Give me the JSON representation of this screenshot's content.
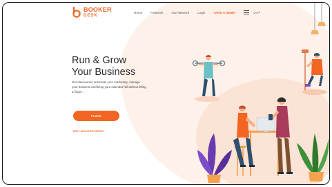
{
  "brand": {
    "name_line1": "BOOKER",
    "name_line2": "DESK",
    "accent_color": "#f26522"
  },
  "nav": {
    "items": [
      {
        "label": "Home"
      },
      {
        "label": "Features"
      },
      {
        "label": "Our Network"
      },
      {
        "label": "Login"
      },
      {
        "label": "TAKE A DEMO",
        "accent": true
      }
    ],
    "menu_icon": "hamburger-icon",
    "language_label": "عربي"
  },
  "hero": {
    "title_line1": "Run & Grow",
    "title_line2": "Your Business",
    "subtitle": "Get discovered, automate your marketing, manage your business and keep your calendar full without lifting a finger...",
    "cta_label": "PLANS",
    "secondary_link": "WHY BOOKER DESK?"
  },
  "colors": {
    "blob_light": "#fdf1e9",
    "blob_mid": "#fbe3d6",
    "accent": "#f26522",
    "heading": "#2b2b2b"
  }
}
